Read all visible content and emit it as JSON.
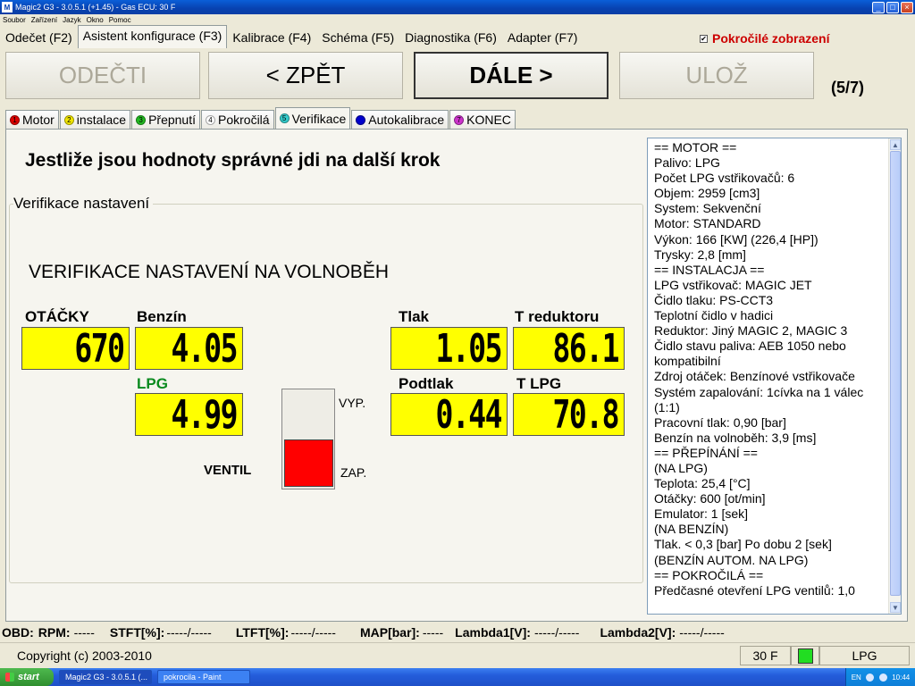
{
  "window": {
    "title": "Magic2 G3 - 3.0.5.1 (+1.45) - Gas ECU: 30 F",
    "app_icon": "M"
  },
  "menu": [
    "Soubor",
    "Zařízení",
    "Jazyk",
    "Okno",
    "Pomoc"
  ],
  "main_tabs": [
    "Odečet (F2)",
    "Asistent konfigurace (F3)",
    "Kalibrace (F4)",
    "Schéma (F5)",
    "Diagnostika (F6)",
    "Adapter (F7)"
  ],
  "advanced_option": {
    "label": "Pokročilé zobrazení",
    "checked": true
  },
  "nav": {
    "read": "ODEČTI",
    "back": "< ZPĚT",
    "next": "DÁLE >",
    "save": "ULOŽ",
    "step": "(5/7)"
  },
  "sub_tabs": [
    {
      "num": "1",
      "label": "Motor",
      "color": "#dd0000"
    },
    {
      "num": "2",
      "label": "instalace",
      "color": "#f2e600"
    },
    {
      "num": "3",
      "label": "Přepnutí",
      "color": "#22bb22"
    },
    {
      "num": "4",
      "label": "Pokročilá",
      "color": "#ffffff"
    },
    {
      "num": "5",
      "label": "Verifikace",
      "color": "#33cccc"
    },
    {
      "num": "",
      "label": "Autokalibrace",
      "color": "#0000cc"
    },
    {
      "num": "7",
      "label": "KONEC",
      "color": "#cc33cc"
    }
  ],
  "instruction": "Jestliže jsou hodnoty správné jdi na další krok",
  "group_title": "Verifikace nastavení",
  "verif_title": "VERIFIKACE NASTAVENÍ NA VOLNOBĚH",
  "gauges": {
    "rpm": {
      "label": "OTÁČKY",
      "value": "670"
    },
    "petrol": {
      "label": "Benzín",
      "value": "4.05"
    },
    "lpg": {
      "label": "LPG",
      "value": "4.99"
    },
    "pressure": {
      "label": "Tlak",
      "value": "1.05"
    },
    "t_reducer": {
      "label": "T reduktoru",
      "value": "86.1"
    },
    "vacuum": {
      "label": "Podtlak",
      "value": "0.44"
    },
    "t_lpg": {
      "label": "T LPG",
      "value": "70.8"
    }
  },
  "valve": {
    "label": "VENTIL",
    "off": "VYP.",
    "on": "ZAP.",
    "state": "on"
  },
  "info_lines": [
    "== MOTOR ==",
    "Palivo: LPG",
    "Počet LPG vstřikovačů: 6",
    "Objem: 2959 [cm3]",
    "System: Sekvenční",
    "Motor: STANDARD",
    "Výkon: 166 [KW] (226,4 [HP])",
    "Trysky: 2,8 [mm]",
    "== INSTALACJA ==",
    "LPG vstřikovač: MAGIC JET",
    "Čidlo tlaku: PS-CCT3",
    "Teplotní čidlo v hadici",
    "Reduktor: Jiný MAGIC 2, MAGIC 3",
    "Čidlo stavu paliva: AEB 1050 nebo",
    "kompatibilní",
    "Zdroj otáček: Benzínové vstřikovače",
    "Systém zapalování: 1cívka na 1 válec",
    "(1:1)",
    "Pracovní tlak: 0,90 [bar]",
    "Benzín na volnoběh: 3,9 [ms]",
    "== PŘEPÍNÁNÍ ==",
    "(NA LPG)",
    "Teplota: 25,4 [°C]",
    "Otáčky: 600 [ot/min]",
    "Emulator: 1 [sek]",
    "(NA BENZÍN)",
    "Tlak. < 0,3 [bar] Po dobu 2 [sek]",
    "(BENZÍN AUTOM. NA LPG)",
    "== POKROČILÁ ==",
    "Předčasné otevření LPG ventilů: 1,0"
  ],
  "obd": [
    {
      "key": "OBD:",
      "value": ""
    },
    {
      "key": "RPM:",
      "value": "-----"
    },
    {
      "key": "STFT[%]:",
      "value": "-----/-----"
    },
    {
      "key": "LTFT[%]:",
      "value": "-----/-----"
    },
    {
      "key": "MAP[bar]:",
      "value": "-----"
    },
    {
      "key": "Lambda1[V]:",
      "value": "-----/-----"
    },
    {
      "key": "Lambda2[V]:",
      "value": "-----/-----"
    }
  ],
  "status": {
    "copyright": "Copyright (c) 2003-2010",
    "ecu": "30 F",
    "fuel": "LPG",
    "led_color": "#22dd22"
  },
  "taskbar": {
    "start": "start",
    "tasks": [
      "Magic2 G3 - 3.0.5.1 (...",
      "pokrocila - Paint"
    ],
    "lang": "EN",
    "clock": "10:44"
  }
}
